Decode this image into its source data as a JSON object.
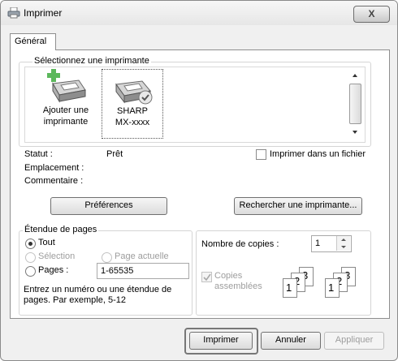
{
  "window": {
    "title": "Imprimer",
    "close_glyph": "X"
  },
  "tabs": [
    {
      "label": "Général"
    }
  ],
  "printer_group": {
    "label": "Sélectionnez une imprimante"
  },
  "printers": [
    {
      "label_line1": "Ajouter une",
      "label_line2": "imprimante",
      "icon": "add-printer-icon"
    },
    {
      "label_line1": "SHARP",
      "label_line2": "MX-xxxx",
      "icon": "printer-default-icon",
      "selected": true
    }
  ],
  "info": {
    "status_label": "Statut :",
    "status_value": "Prêt",
    "location_label": "Emplacement :",
    "comment_label": "Commentaire :",
    "print_to_file": "Imprimer dans un fichier"
  },
  "buttons": {
    "preferences": "Préférences",
    "find_printer": "Rechercher une imprimante...",
    "print": "Imprimer",
    "cancel": "Annuler",
    "apply": "Appliquer"
  },
  "page_range": {
    "label": "Étendue de pages",
    "all": "Tout",
    "selection": "Sélection",
    "current_page": "Page actuelle",
    "pages": "Pages :",
    "pages_value": "1-65535",
    "hint_line1": "Entrez un numéro ou une étendue de",
    "hint_line2": "pages. Par exemple, 5-12"
  },
  "copies": {
    "label": "Nombre de copies :",
    "value": "1",
    "collate_line1": "Copies",
    "collate_line2": "assemblées",
    "stack_numbers": [
      "1",
      "2",
      "3"
    ]
  }
}
